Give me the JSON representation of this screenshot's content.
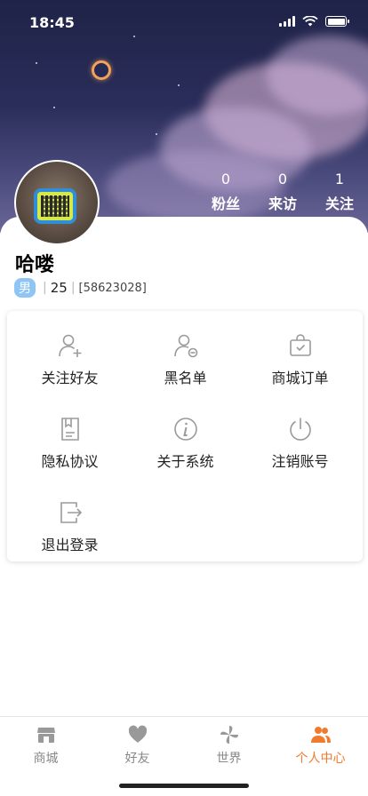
{
  "status_bar": {
    "time": "18:45"
  },
  "profile": {
    "stats": [
      {
        "value": "0",
        "label": "粉丝"
      },
      {
        "value": "0",
        "label": "来访"
      },
      {
        "value": "1",
        "label": "关注"
      }
    ],
    "nickname": "哈喽",
    "gender": "男",
    "age": "25",
    "user_id": "[58623028]"
  },
  "menu": {
    "items": [
      {
        "label": "关注好友",
        "icon": "add-user-icon"
      },
      {
        "label": "黑名单",
        "icon": "block-user-icon"
      },
      {
        "label": "商城订单",
        "icon": "shopping-bag-icon"
      },
      {
        "label": "隐私协议",
        "icon": "document-icon"
      },
      {
        "label": "关于系统",
        "icon": "info-icon"
      },
      {
        "label": "注销账号",
        "icon": "power-icon"
      },
      {
        "label": "退出登录",
        "icon": "logout-icon"
      }
    ]
  },
  "tabbar": {
    "tabs": [
      {
        "label": "商城",
        "icon": "store-icon"
      },
      {
        "label": "好友",
        "icon": "heart-icon"
      },
      {
        "label": "世界",
        "icon": "pinwheel-icon"
      },
      {
        "label": "个人中心",
        "icon": "people-icon"
      }
    ],
    "active_index": 3
  },
  "colors": {
    "accent": "#f07b2d",
    "gender_badge": "#8ec5f5",
    "icon_gray": "#9a9a9a"
  }
}
